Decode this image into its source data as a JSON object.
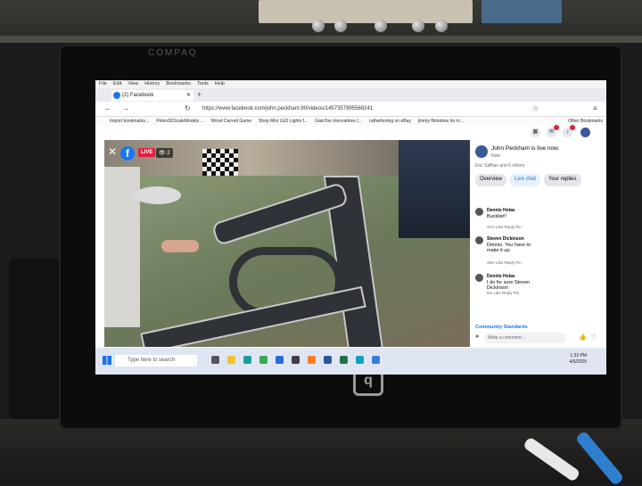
{
  "monitor": {
    "brand": "COMPAQ",
    "logo": "q"
  },
  "browser": {
    "menu": [
      "File",
      "Edit",
      "View",
      "History",
      "Bookmarks",
      "Tools",
      "Help"
    ],
    "tab": {
      "title": "(2) Facebook"
    },
    "url": "https://www.facebook.com/john.peckham.90/videos/1457357995569241",
    "bookmarks": [
      "Import bookmarks...",
      "Petes3DScaleModels ...",
      "Wood Carved Game",
      "Shop Mini LED Lights f...",
      "GatoToe Innovations (...",
      "ratherboring on eBay",
      "jimmy flintstone ho m..."
    ],
    "bookmarks_right": "Other Bookmarks"
  },
  "video": {
    "live_label": "LIVE",
    "viewer_count": "2"
  },
  "panel": {
    "streamer": "John Peckham is live now.",
    "sub": "Now",
    "reactions": "Eric Saffran and 6 others",
    "tabs": [
      "Overview",
      "Live chat",
      "Your replies"
    ],
    "comments": [
      {
        "name": "Dennis Holas",
        "text": "Bucklist!!",
        "actions": "41m   Like   Reply   Pin"
      },
      {
        "name": "Steven Dickinson",
        "text": "Dennis. You have to make it up.",
        "actions": "20m   Like   Reply   Pin"
      },
      {
        "name": "Dennis Holas",
        "text": "I do for sure Steven Dickinson",
        "actions": "5m   Like   Reply   Pin"
      }
    ],
    "community": "Community Standards",
    "comment_placeholder": "Write a comment..."
  },
  "taskbar": {
    "search_placeholder": "Type here to search",
    "time": "1:33 PM",
    "date": "4/5/2025"
  },
  "colors": {
    "facebook_blue": "#1877f2",
    "live_red": "#e41e3f"
  }
}
